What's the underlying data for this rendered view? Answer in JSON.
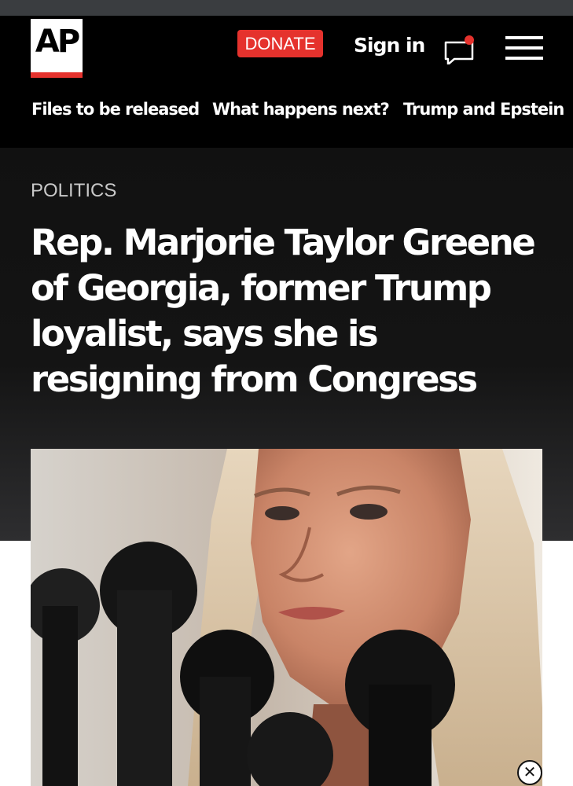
{
  "header": {
    "logo_text": "AP",
    "donate_label": "DONATE",
    "signin_label": "Sign in",
    "icons": {
      "chat": "chat-bubble-icon",
      "menu": "hamburger-menu-icon",
      "notification": "notification-dot"
    },
    "accent_color": "#e5322d"
  },
  "nav": {
    "items": [
      {
        "label": "Files to be released"
      },
      {
        "label": "What happens next?"
      },
      {
        "label": "Trump and Epstein"
      }
    ]
  },
  "article": {
    "section": "POLITICS",
    "headline": "Rep. Marjorie Taylor Greene of Georgia, former Trump loyalist, says she is resigning from Congress",
    "photo": {
      "subject": "woman-at-microphones"
    }
  },
  "ad": {
    "close_icon": "close-x-icon"
  }
}
